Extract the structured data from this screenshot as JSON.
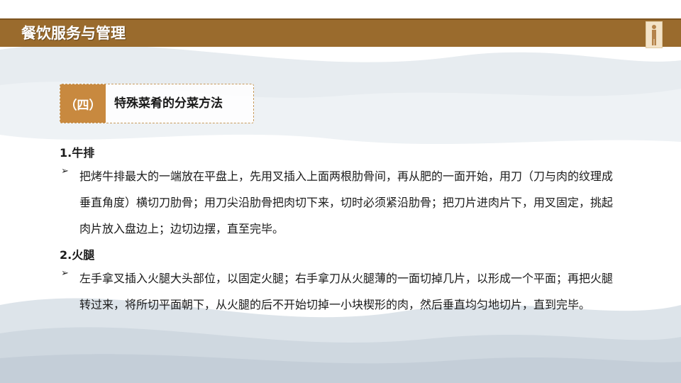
{
  "header": {
    "title": "餐饮服务与管理"
  },
  "section": {
    "number": "（四）",
    "title": "特殊菜肴的分菜方法"
  },
  "items": [
    {
      "heading": "1.牛排",
      "text": "把烤牛排最大的一端放在平盘上，先用叉插入上面两根肋骨间，再从肥的一面开始，用刀（刀与肉的纹理成垂直角度）横切刀肋骨；用刀尖沿肋骨把肉切下来，切时必须紧沿肋骨；把刀片进肉片下，用叉固定，挑起肉片放入盘边上；边切边摆，直至完毕。"
    },
    {
      "heading": "2.火腿",
      "text": "左手拿叉插入火腿大头部位，以固定火腿；右手拿刀从火腿薄的一面切掉几片，以形成一个平面；再把火腿转过来，将所切平面朝下，从火腿的后不开始切掉一小块楔形的肉，然后垂直均匀地切片，直到完毕。"
    }
  ],
  "colors": {
    "header_bar": "#9a6b2d",
    "accent": "#c8893f",
    "wave": "#c9d3dc"
  },
  "icons": {
    "bullet": "arrow-bullet-icon",
    "logo": "figure-logo-icon"
  }
}
